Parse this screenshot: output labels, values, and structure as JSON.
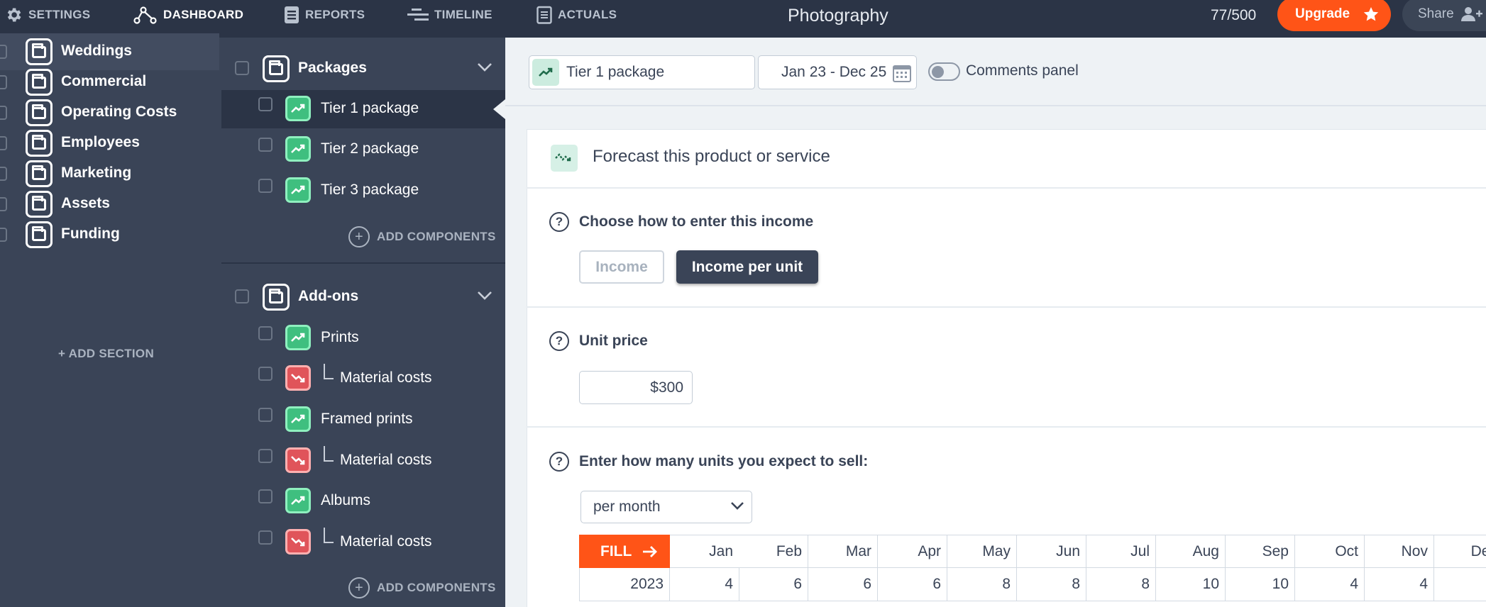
{
  "nav": {
    "settings": "SETTINGS",
    "dashboard": "DASHBOARD",
    "reports": "REPORTS",
    "timeline": "TIMELINE",
    "actuals": "ACTUALS"
  },
  "app_title": "Photography",
  "usage_count": "77/500",
  "upgrade_label": "Upgrade",
  "share_label": "Share",
  "sections": [
    "Weddings",
    "Commercial",
    "Operating Costs",
    "Employees",
    "Marketing",
    "Assets",
    "Funding"
  ],
  "add_section_label": "+ ADD SECTION",
  "groups": {
    "packages": {
      "label": "Packages",
      "items": [
        "Tier 1 package",
        "Tier 2 package",
        "Tier 3 package"
      ]
    },
    "addons": {
      "label": "Add-ons",
      "items": [
        "Prints",
        "Material costs",
        "Framed prints",
        "Material costs",
        "Albums",
        "Material costs"
      ]
    }
  },
  "add_components_label": "ADD COMPONENTS",
  "toolbar": {
    "selected_component": "Tier 1 package",
    "date_range": "Jan 23 - Dec 25",
    "comments_label": "Comments panel"
  },
  "forecast": {
    "title": "Forecast this product or service",
    "choose_label": "Choose how to enter this income",
    "income_btn": "Income",
    "income_per_unit_btn": "Income per unit",
    "unit_price_label": "Unit price",
    "unit_price_value": "$300",
    "units_label": "Enter how many units you expect to sell:",
    "frequency": "per month"
  },
  "grid": {
    "fill_label": "FILL",
    "months": [
      "Jan",
      "Feb",
      "Mar",
      "Apr",
      "May",
      "Jun",
      "Jul",
      "Aug",
      "Sep",
      "Oct",
      "Nov",
      "Dec"
    ],
    "rows": [
      {
        "year": "2023",
        "values": [
          "4",
          "6",
          "6",
          "6",
          "8",
          "8",
          "8",
          "10",
          "10",
          "4",
          "4",
          ""
        ]
      }
    ]
  },
  "colors": {
    "topbar": "#2b3446",
    "sidebar": "#3a4457",
    "accent_orange": "#ff5417",
    "income_green": "#3fbf7f",
    "cost_red": "#e0545a"
  }
}
